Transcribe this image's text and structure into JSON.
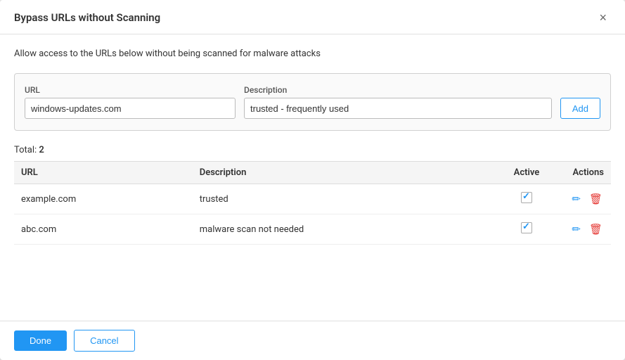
{
  "dialog": {
    "title": "Bypass URLs without Scanning",
    "description": "Allow access to the URLs below without being scanned for malware attacks",
    "close_label": "×"
  },
  "form": {
    "url_label": "URL",
    "url_placeholder": "windows-updates.com",
    "desc_label": "Description",
    "desc_placeholder": "trusted - frequently used",
    "add_label": "Add"
  },
  "table": {
    "total_prefix": "Total: ",
    "total_count": "2",
    "columns": {
      "url": "URL",
      "description": "Description",
      "active": "Active",
      "actions": "Actions"
    },
    "rows": [
      {
        "url": "example.com",
        "description": "trusted",
        "active": true
      },
      {
        "url": "abc.com",
        "description": "malware scan not needed",
        "active": true
      }
    ]
  },
  "footer": {
    "done_label": "Done",
    "cancel_label": "Cancel"
  }
}
